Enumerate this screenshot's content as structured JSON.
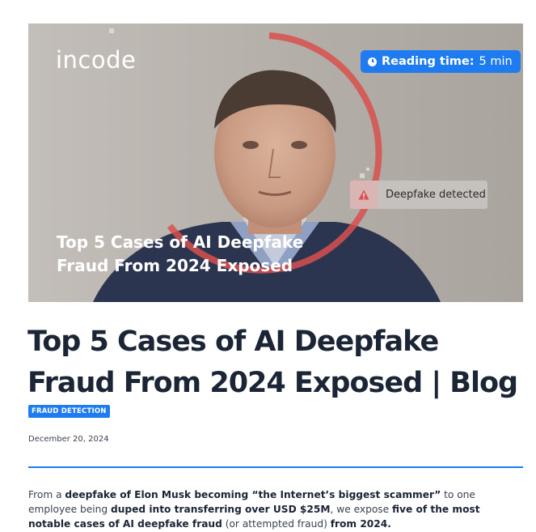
{
  "hero": {
    "logo": "incode",
    "reading_time_label": "Reading time:",
    "reading_time_value": "5 min",
    "badge_text": "Deepfake detected",
    "overlay_title": "Top 5 Cases of AI Deepfake Fraud From 2024 Exposed"
  },
  "article": {
    "title": "Top 5 Cases of AI Deepfake Fraud From 2024 Exposed | Blog",
    "tag": "FRAUD DETECTION",
    "date": "December 20, 2024",
    "intro": [
      {
        "text": "From a ",
        "bold": false
      },
      {
        "text": "deepfake of Elon Musk becoming “the Internet’s biggest scammer”",
        "bold": true
      },
      {
        "text": " to one employee being ",
        "bold": false
      },
      {
        "text": "duped into transferring over USD $25M",
        "bold": true
      },
      {
        "text": ", we expose ",
        "bold": false
      },
      {
        "text": "five of the most notable cases of AI deepfake fraud",
        "bold": true
      },
      {
        "text": " (or attempted fraud) ",
        "bold": false
      },
      {
        "text": "from 2024.",
        "bold": true
      }
    ]
  },
  "colors": {
    "accent": "#1f7cf0",
    "ring": "#d8504f",
    "title": "#1b2535"
  },
  "icons": {
    "clock": "clock-icon",
    "warning": "warning-icon"
  }
}
